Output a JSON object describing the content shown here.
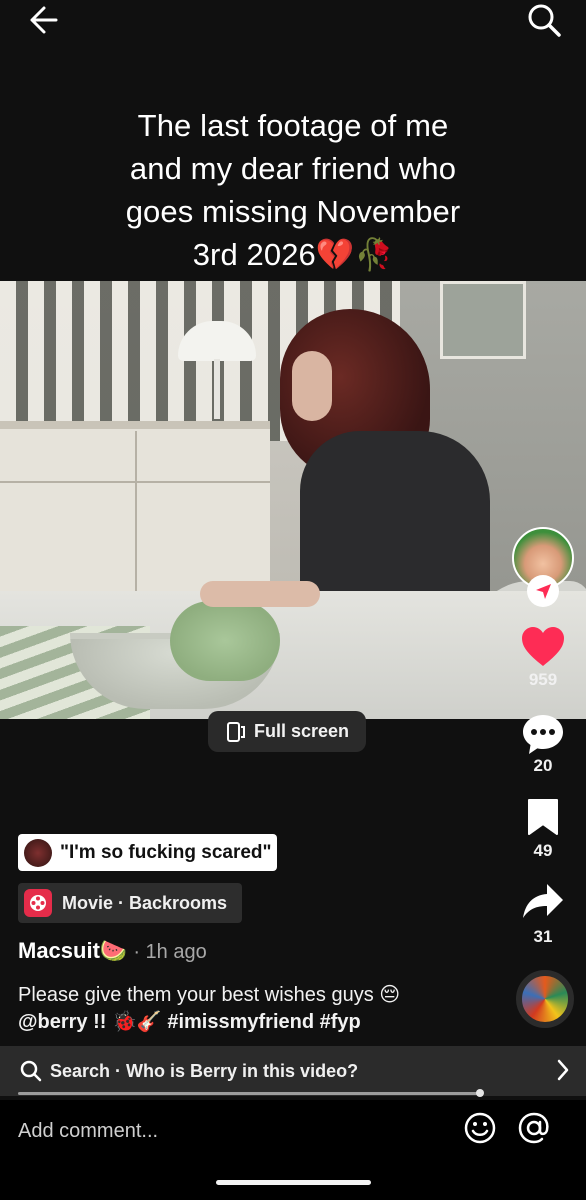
{
  "caption": {
    "line1": "The last footage of me",
    "line2": "and my dear friend who",
    "line3": "goes missing November",
    "line4": "3rd 2026💔🥀"
  },
  "fullscreen_button": {
    "label": "Full screen"
  },
  "rail": {
    "likes": "959",
    "comments": "20",
    "saves": "49",
    "shares": "31",
    "like_color": "#fe2c55"
  },
  "sound_chip": {
    "label": "\"I'm so fucking scared\""
  },
  "movie_chip": {
    "label": "Movie · Backrooms"
  },
  "post": {
    "author": "Macsuit🍉",
    "time": "· 1h ago",
    "line1": "Please give them your best wishes guys 😔",
    "mention": "@berry !! 🐞🎸",
    "tag1": "#imissmyfriend",
    "tag2": "#fyp"
  },
  "search_bar": {
    "label": "Search · Who is Berry in this video?"
  },
  "comment_bar": {
    "placeholder": "Add comment..."
  },
  "icons": [
    "back-arrow-icon",
    "search-icon",
    "fullscreen-icon",
    "follow-plus-icon",
    "heart-icon",
    "comment-icon",
    "bookmark-icon",
    "share-icon",
    "music-disc-icon",
    "emoji-icon",
    "at-icon",
    "chevron-right-icon"
  ]
}
